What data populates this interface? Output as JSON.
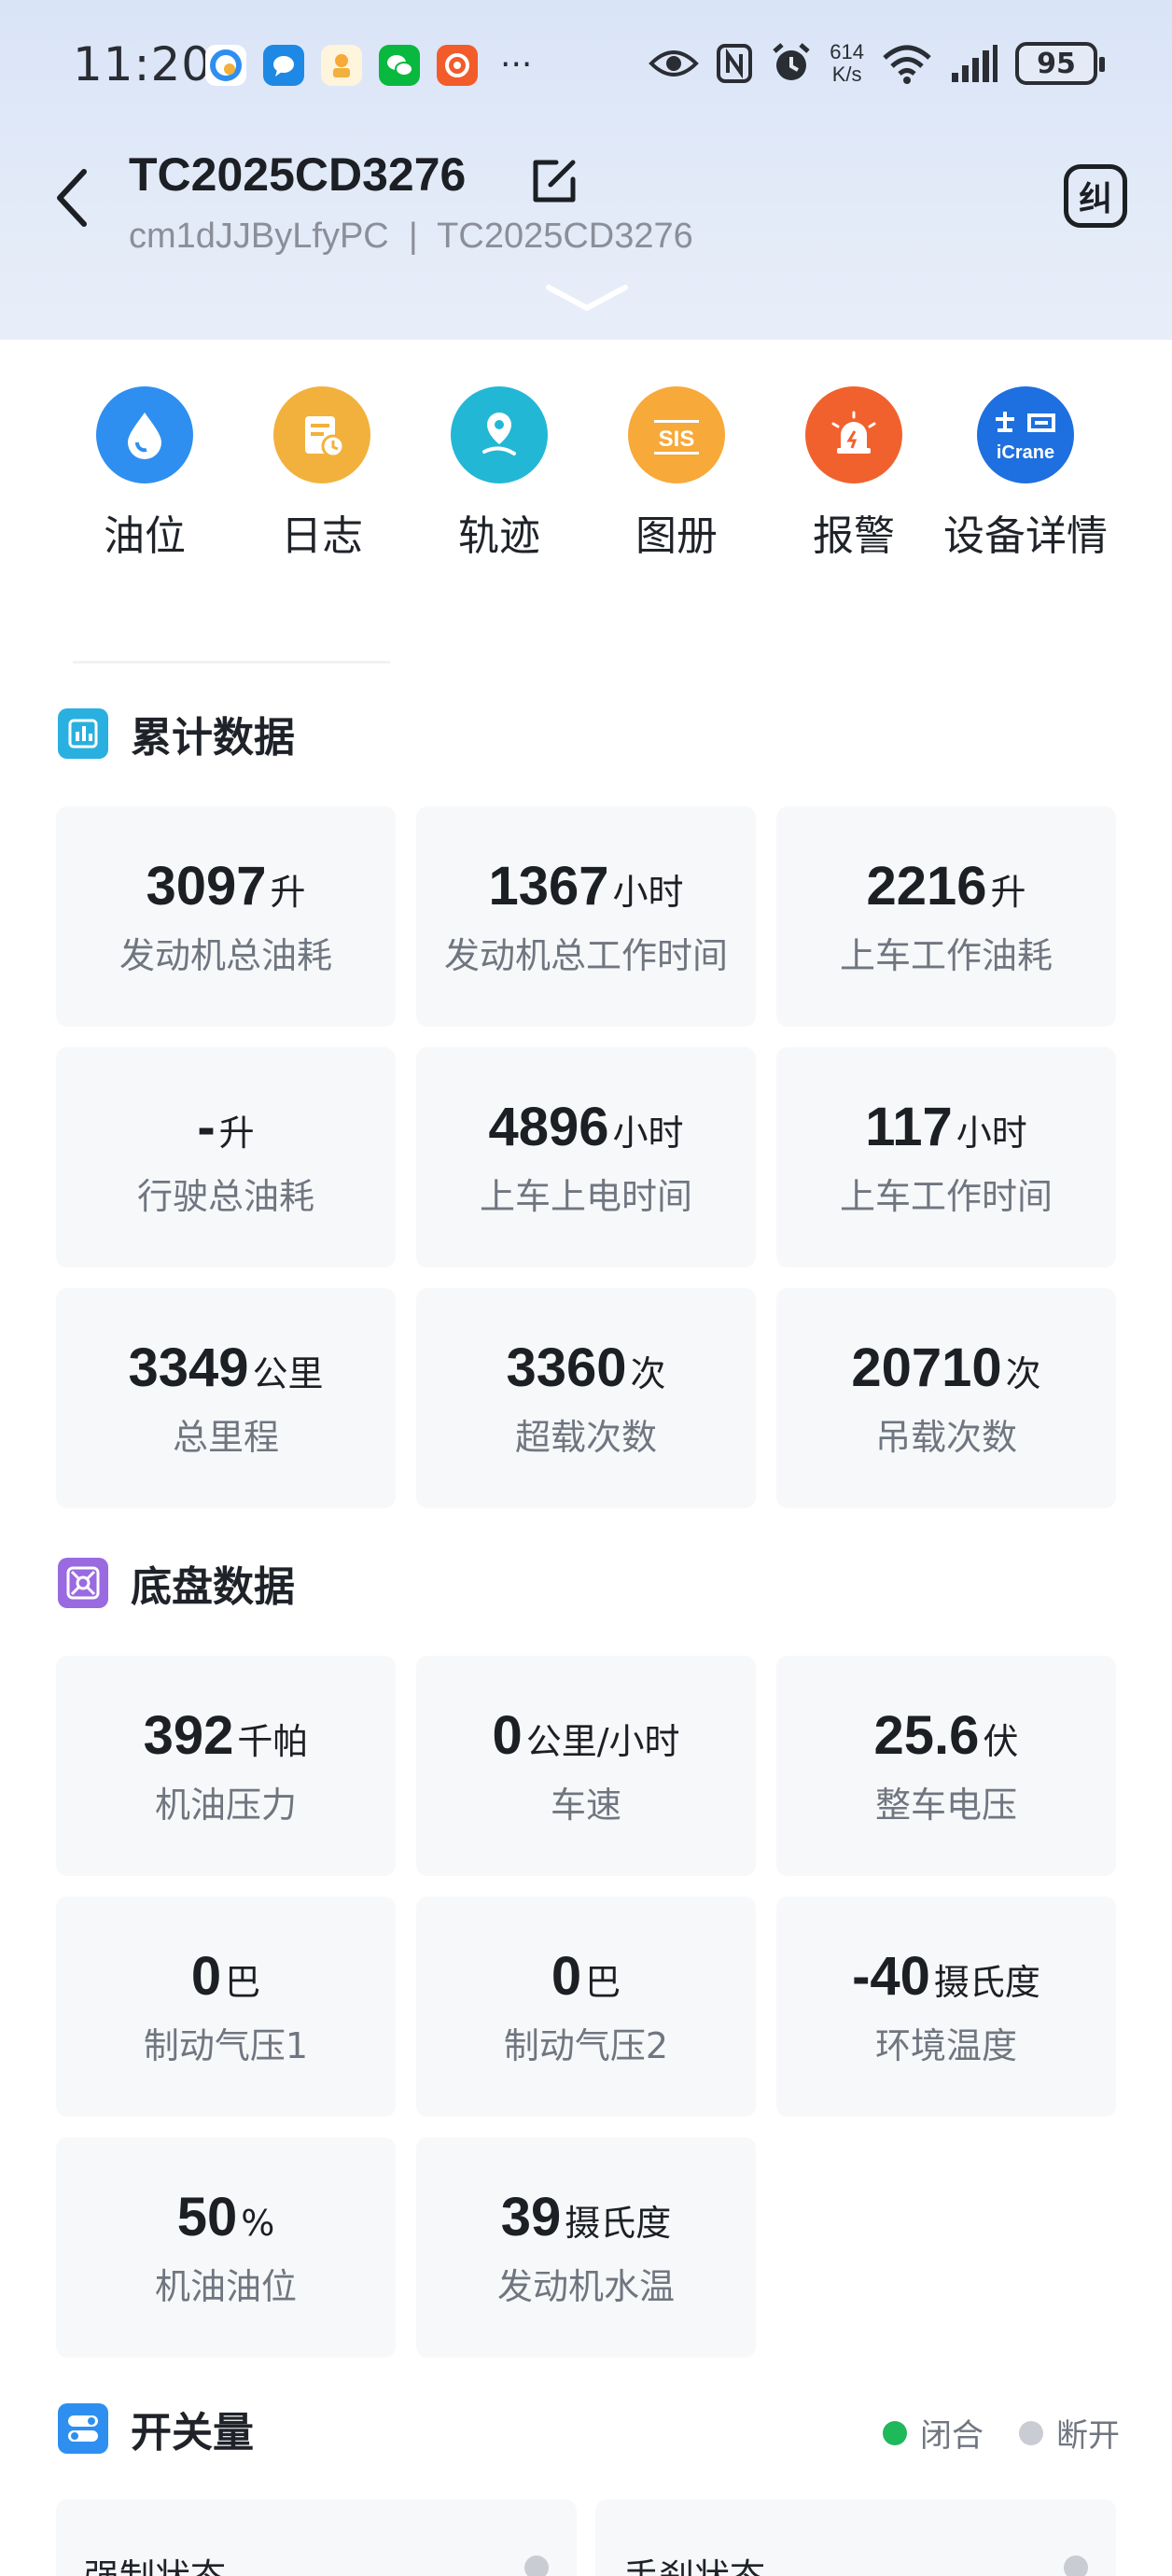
{
  "status_bar": {
    "time": "11:20",
    "net_speed_value": "614",
    "net_speed_unit": "K/s",
    "battery": "95",
    "more": "···"
  },
  "header": {
    "title": "TC2025CD3276",
    "subtitle": "cm1dJJByLfyPC  |  TC2025CD3276",
    "right_button": "纠"
  },
  "quick_nav": [
    {
      "label": "油位",
      "icon": "oil-drop-icon",
      "color": "#2e8ff0"
    },
    {
      "label": "日志",
      "icon": "log-icon",
      "color": "#f2b13c"
    },
    {
      "label": "轨迹",
      "icon": "location-track-icon",
      "color": "#23b7d6"
    },
    {
      "label": "图册",
      "icon": "sis-atlas-icon",
      "color": "#f7a93a"
    },
    {
      "label": "报警",
      "icon": "alarm-icon",
      "color": "#f1612e"
    },
    {
      "label": "设备详情",
      "icon": "icrane-icon",
      "color": "#1e6fe0"
    }
  ],
  "cumulative": {
    "title": "累计数据",
    "cards": [
      {
        "value": "3097",
        "unit": "升",
        "label": "发动机总油耗"
      },
      {
        "value": "1367",
        "unit": "小时",
        "label": "发动机总工作时间"
      },
      {
        "value": "2216",
        "unit": "升",
        "label": "上车工作油耗"
      },
      {
        "value": "-",
        "unit": "升",
        "label": "行驶总油耗"
      },
      {
        "value": "4896",
        "unit": "小时",
        "label": "上车上电时间"
      },
      {
        "value": "117",
        "unit": "小时",
        "label": "上车工作时间"
      },
      {
        "value": "3349",
        "unit": "公里",
        "label": "总里程"
      },
      {
        "value": "3360",
        "unit": "次",
        "label": "超载次数"
      },
      {
        "value": "20710",
        "unit": "次",
        "label": "吊载次数"
      }
    ]
  },
  "chassis": {
    "title": "底盘数据",
    "cards": [
      {
        "value": "392",
        "unit": "千帕",
        "label": "机油压力"
      },
      {
        "value": "0",
        "unit": "公里/小时",
        "label": "车速"
      },
      {
        "value": "25.6",
        "unit": "伏",
        "label": "整车电压"
      },
      {
        "value": "0",
        "unit": "巴",
        "label": "制动气压1"
      },
      {
        "value": "0",
        "unit": "巴",
        "label": "制动气压2"
      },
      {
        "value": "-40",
        "unit": "摄氏度",
        "label": "环境温度"
      },
      {
        "value": "50",
        "unit": "%",
        "label": "机油油位"
      },
      {
        "value": "39",
        "unit": "摄氏度",
        "label": "发动机水温"
      }
    ]
  },
  "switches": {
    "title": "开关量",
    "legend": [
      {
        "label": "闭合",
        "color": "#1fb85a"
      },
      {
        "label": "断开",
        "color": "#c9ccd2"
      }
    ],
    "items": [
      {
        "label": "强制状态",
        "state": "断开"
      },
      {
        "label": "手刹状态",
        "state": "断开"
      }
    ]
  }
}
